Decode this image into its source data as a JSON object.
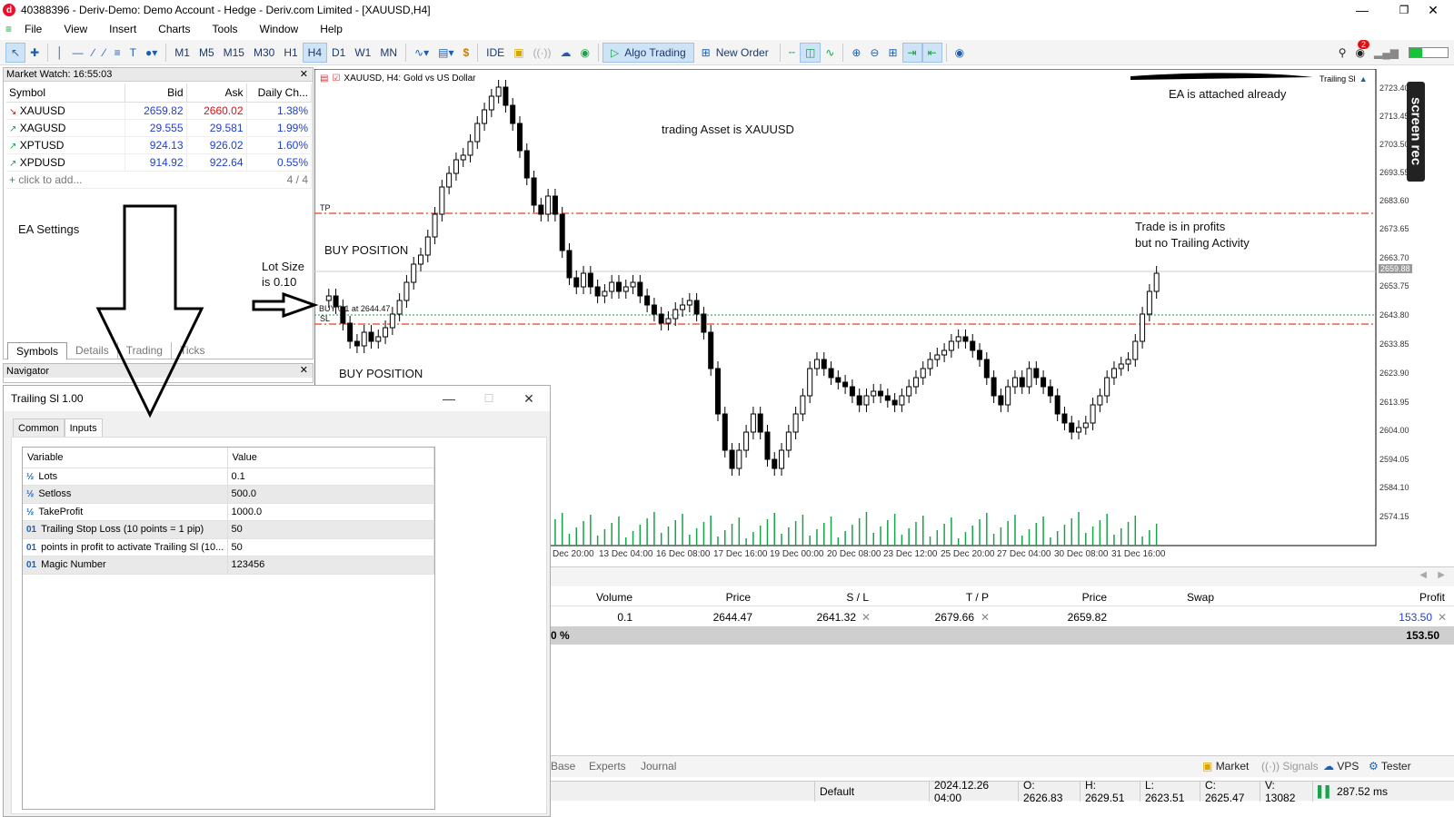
{
  "window": {
    "title": "40388396 - Deriv-Demo: Demo Account - Hedge - Deriv.com Limited - [XAUUSD,H4]",
    "app_icon": "d"
  },
  "menu": [
    "File",
    "View",
    "Insert",
    "Charts",
    "Tools",
    "Window",
    "Help"
  ],
  "toolbar": {
    "timeframes": [
      "M1",
      "M5",
      "M15",
      "M30",
      "H1",
      "H4",
      "D1",
      "W1",
      "MN"
    ],
    "selected_timeframe": "H4",
    "ide": "IDE",
    "algo_trading": "Algo Trading",
    "new_order": "New Order",
    "notif_count": "2"
  },
  "market_watch": {
    "title": "Market Watch: 16:55:03",
    "columns": [
      "Symbol",
      "Bid",
      "Ask",
      "Daily Ch..."
    ],
    "rows": [
      {
        "symbol": "XAUUSD",
        "bid": "2659.82",
        "ask": "2660.02",
        "change": "1.38%",
        "dir": "down"
      },
      {
        "symbol": "XAGUSD",
        "bid": "29.555",
        "ask": "29.581",
        "change": "1.99%",
        "dir": "up"
      },
      {
        "symbol": "XPTUSD",
        "bid": "924.13",
        "ask": "926.02",
        "change": "1.60%",
        "dir": "up"
      },
      {
        "symbol": "XPDUSD",
        "bid": "914.92",
        "ask": "922.64",
        "change": "0.55%",
        "dir": "up"
      }
    ],
    "add_text": "click to add...",
    "count": "4 / 4",
    "tabs": [
      "Symbols",
      "Details",
      "Trading",
      "Ticks"
    ]
  },
  "navigator": {
    "title": "Navigator"
  },
  "annotations": {
    "ea_settings": "EA Settings",
    "lot_size_1": "Lot Size",
    "lot_size_2": "is 0.10",
    "trading_asset": "trading Asset is XAUUSD",
    "buy_position_1": "BUY POSITION",
    "buy_position_2": "BUY POSITION",
    "ea_attached": "EA is attached already",
    "profit_1": "Trade is in profits",
    "profit_2": "but no Trailing Activity"
  },
  "chart": {
    "header": "XAUUSD, H4:  Gold vs US Dollar",
    "ea_name": "Trailing Sl",
    "tp_label": "TP",
    "sl_label": "SL",
    "buy_label": "BUY 0.1 at 2644.47",
    "current_price": "2659.88",
    "price_labels": [
      "2723.40",
      "2713.45",
      "2703.50",
      "2693.55",
      "2683.60",
      "2673.65",
      "2663.70",
      "2653.75",
      "2643.80",
      "2633.85",
      "2623.90",
      "2613.95",
      "2604.00",
      "2594.05",
      "2584.10",
      "2574.15"
    ],
    "time_labels": [
      "Dec 20:00",
      "13 Dec 04:00",
      "16 Dec 08:00",
      "17 Dec 16:00",
      "19 Dec 00:00",
      "20 Dec 08:00",
      "23 Dec 12:00",
      "25 Dec 20:00",
      "27 Dec 04:00",
      "30 Dec 08:00",
      "31 Dec 16:00"
    ]
  },
  "dialog": {
    "title": "Trailing Sl 1.00",
    "tabs": [
      "Common",
      "Inputs"
    ],
    "columns": [
      "Variable",
      "Value"
    ],
    "params": [
      {
        "icon": "½",
        "name": "Lots",
        "value": "0.1"
      },
      {
        "icon": "½",
        "name": "Setloss",
        "value": "500.0"
      },
      {
        "icon": "½",
        "name": "TakeProfit",
        "value": "1000.0"
      },
      {
        "icon": "01",
        "name": "Trailing Stop Loss (10 points = 1 pip)",
        "value": "50"
      },
      {
        "icon": "01",
        "name": "points in profit to activate Trailing Sl (10...",
        "value": "50"
      },
      {
        "icon": "01",
        "name": "Magic Number",
        "value": "123456"
      }
    ]
  },
  "toolbox": {
    "columns": [
      "Volume",
      "Price",
      "S / L",
      "T / P",
      "Price",
      "Swap",
      "Profit"
    ],
    "position": {
      "volume": "0.1",
      "price": "2644.47",
      "sl": "2641.32",
      "tp": "2679.66",
      "cur_price": "2659.82",
      "profit": "153.50"
    },
    "total_left": "0 %",
    "total_profit": "153.50",
    "tabs": [
      "Base",
      "Experts",
      "Journal"
    ],
    "right_tabs": [
      "Market",
      "Signals",
      "VPS",
      "Tester"
    ]
  },
  "status": {
    "profile": "Default",
    "time": "2024.12.26 04:00",
    "open": "O: 2626.83",
    "high": "H: 2629.51",
    "low": "L: 2623.51",
    "close": "C: 2625.47",
    "volume": "V: 13082",
    "speed": "287.52 ms"
  },
  "recorder": "screen rec",
  "colors": {
    "accent": "#1c5fb0",
    "bid_blue": "#1f3fd0",
    "ask_red": "#e01010",
    "level_red": "#e53e1a",
    "entry_green": "#159a3a"
  }
}
